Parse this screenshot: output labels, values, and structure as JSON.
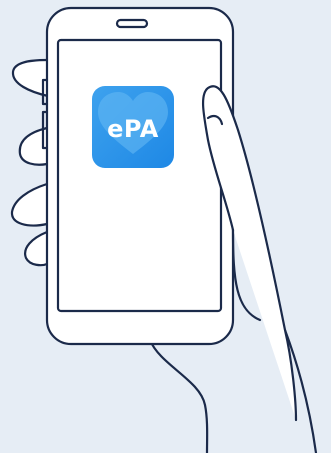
{
  "app_icon": {
    "label": "ePA",
    "icon": "heart-icon",
    "colors": {
      "tile": "#1e88e5",
      "tile_light": "#3ea2ee",
      "heart": "#5fb6f2",
      "text": "#ffffff"
    }
  },
  "illustration": {
    "subject": "hand-holding-smartphone",
    "colors": {
      "background": "#e6edf5",
      "outline": "#1b2a4a",
      "screen": "#ffffff",
      "fill": "#ffffff"
    }
  }
}
